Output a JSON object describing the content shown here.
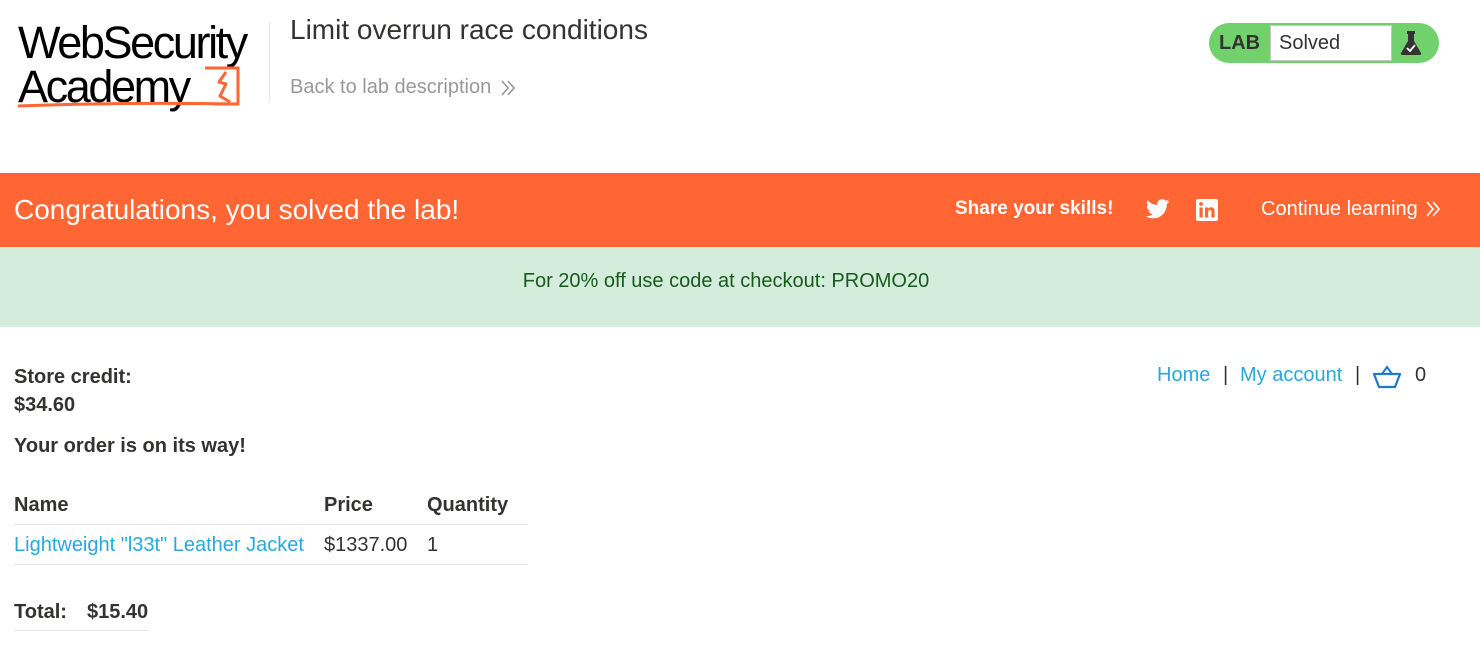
{
  "logo": {
    "line1": "WebSecurity",
    "line2": "Academy"
  },
  "header": {
    "lab_title": "Limit overrun race conditions",
    "back_link": "Back to lab description"
  },
  "lab_status": {
    "badge": "LAB",
    "status": "Solved"
  },
  "banner": {
    "message": "Congratulations, you solved the lab!",
    "share": "Share your skills!",
    "continue": "Continue learning"
  },
  "promo": {
    "text": "For 20% off use code at checkout: PROMO20"
  },
  "nav": {
    "home": "Home",
    "separator": "|",
    "my_account": "My account",
    "cart_count": "0"
  },
  "account": {
    "credit_label": "Store credit:",
    "credit_value": "$34.60",
    "order_message": "Your order is on its way!"
  },
  "order": {
    "columns": [
      "Name",
      "Price",
      "Quantity"
    ],
    "rows": [
      {
        "name": "Lightweight \"l33t\" Leather Jacket",
        "price": "$1337.00",
        "quantity": "1"
      }
    ],
    "total_label": "Total:",
    "total_value": "$15.40"
  },
  "colors": {
    "brand_orange": "#ff6633",
    "lab_green": "#70d16d",
    "link_blue": "#29a8dc",
    "promo_bg": "#d4ecdc",
    "promo_text": "#185a1d"
  },
  "icons": {
    "logo_mark": "academy-logo-mark",
    "back": "double-chevron-right-icon",
    "status": "flask-icon",
    "share_1": "twitter-icon",
    "share_2": "linkedin-icon",
    "continue": "double-chevron-right-icon",
    "cart": "basket-icon"
  }
}
